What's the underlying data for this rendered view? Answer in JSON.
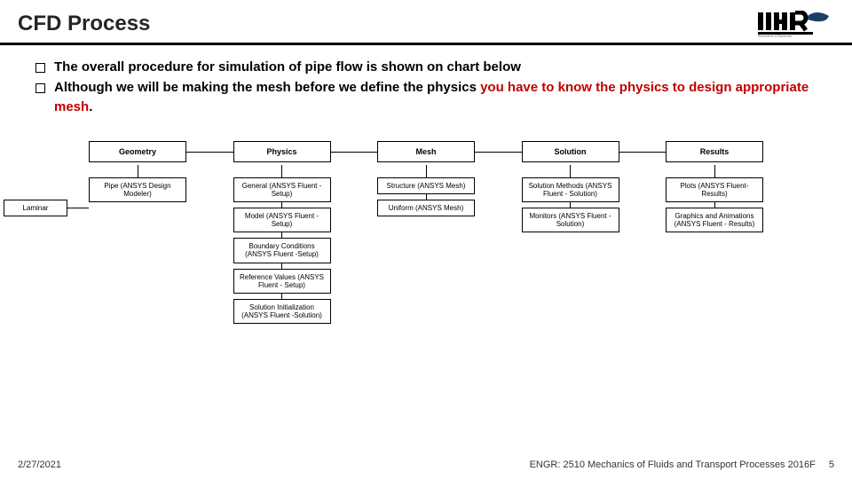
{
  "header": {
    "title": "CFD Process"
  },
  "bullets": {
    "b1": "The overall procedure for simulation of pipe flow is shown on chart below",
    "b2_a": "Although we will be making the mesh before we define the physics ",
    "b2_b": "you have to know the physics to design appropriate mesh",
    "b2_c": "."
  },
  "chart": {
    "top": {
      "geometry": "Geometry",
      "physics": "Physics",
      "mesh": "Mesh",
      "solution": "Solution",
      "results": "Results"
    },
    "geometry_children": {
      "pipe": "Pipe (ANSYS Design Modeler)"
    },
    "side": {
      "laminar": "Laminar"
    },
    "physics_children": {
      "general": "General (ANSYS Fluent - Setup)",
      "model": "Model (ANSYS Fluent - Setup)",
      "bc": "Boundary Conditions (ANSYS Fluent -Setup)",
      "ref": "Reference Values (ANSYS Fluent - Setup)",
      "init": "Solution Initialization (ANSYS Fluent -Solution)"
    },
    "mesh_children": {
      "structure": "Structure (ANSYS Mesh)",
      "uniform": "Uniform (ANSYS Mesh)"
    },
    "solution_children": {
      "methods": "Solution Methods (ANSYS Fluent - Solution)",
      "monitors": "Monitors (ANSYS Fluent - Solution)"
    },
    "results_children": {
      "plots": "Plots (ANSYS Fluent- Results)",
      "graphics": "Graphics and Animations (ANSYS Fluent - Results)"
    }
  },
  "footer": {
    "date": "2/27/2021",
    "course": "ENGR: 2510 Mechanics of Fluids and Transport Processes 2016F",
    "page": "5"
  }
}
